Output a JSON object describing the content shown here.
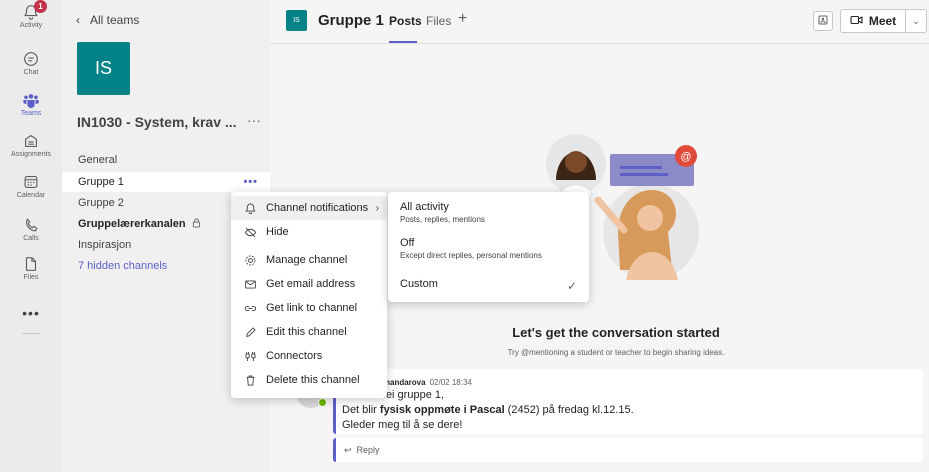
{
  "appbar": {
    "items": [
      {
        "label": "Activity",
        "icon": "bell-icon",
        "badge": "1"
      },
      {
        "label": "Chat",
        "icon": "chat-icon"
      },
      {
        "label": "Teams",
        "icon": "teams-icon"
      },
      {
        "label": "Assignments",
        "icon": "assignments-icon"
      },
      {
        "label": "Calendar",
        "icon": "calendar-icon"
      },
      {
        "label": "Calls",
        "icon": "phone-icon"
      },
      {
        "label": "Files",
        "icon": "file-icon"
      }
    ],
    "more": "•••"
  },
  "sidebar": {
    "back_label": "All teams",
    "team_initials": "IS",
    "team_name": "IN1030 - System, krav ...",
    "team_more": "···",
    "channels": [
      {
        "label": "General"
      },
      {
        "label": "Gruppe 1"
      },
      {
        "label": "Gruppe 2"
      },
      {
        "label": "Gruppelærerkanalen"
      },
      {
        "label": "Inspirasjon"
      },
      {
        "label": "7 hidden channels"
      }
    ],
    "channel_more": "•••"
  },
  "header": {
    "initials": "IS",
    "title": "Gruppe 1",
    "tabs": [
      {
        "label": "Posts"
      },
      {
        "label": "Files"
      }
    ],
    "add": "+",
    "meet_label": "Meet"
  },
  "main": {
    "empty_title": "Let's get the conversation started",
    "empty_subtitle": "Try @mentioning a student or teacher to begin sharing ideas."
  },
  "post": {
    "author": "hmandarova",
    "time": "02/02 18:34",
    "line1": "Hei gruppe 1,",
    "line2_pre": "Det blir ",
    "line2_bold": "fysisk oppmøte i Pascal",
    "line2_post": " (2452) på fredag kl.12.15.",
    "line3": "Gleder meg til å se dere!",
    "reply": "Reply"
  },
  "context_menu": {
    "items": [
      {
        "label": "Channel notifications",
        "icon": "bell-icon"
      },
      {
        "label": "Hide",
        "icon": "eye-off-icon"
      },
      {
        "label": "Manage channel",
        "icon": "gear-icon"
      },
      {
        "label": "Get email address",
        "icon": "mail-icon"
      },
      {
        "label": "Get link to channel",
        "icon": "link-icon"
      },
      {
        "label": "Edit this channel",
        "icon": "pencil-icon"
      },
      {
        "label": "Connectors",
        "icon": "connectors-icon"
      },
      {
        "label": "Delete this channel",
        "icon": "trash-icon"
      }
    ]
  },
  "submenu": {
    "items": [
      {
        "title": "All activity",
        "desc": "Posts, replies, mentions"
      },
      {
        "title": "Off",
        "desc": "Except direct replies, personal mentions"
      },
      {
        "title": "Custom",
        "desc": ""
      }
    ]
  },
  "colors": {
    "accent": "#5b5fc7",
    "team_avatar": "#038387",
    "badge": "#c4314b",
    "presence": "#6bb700"
  }
}
